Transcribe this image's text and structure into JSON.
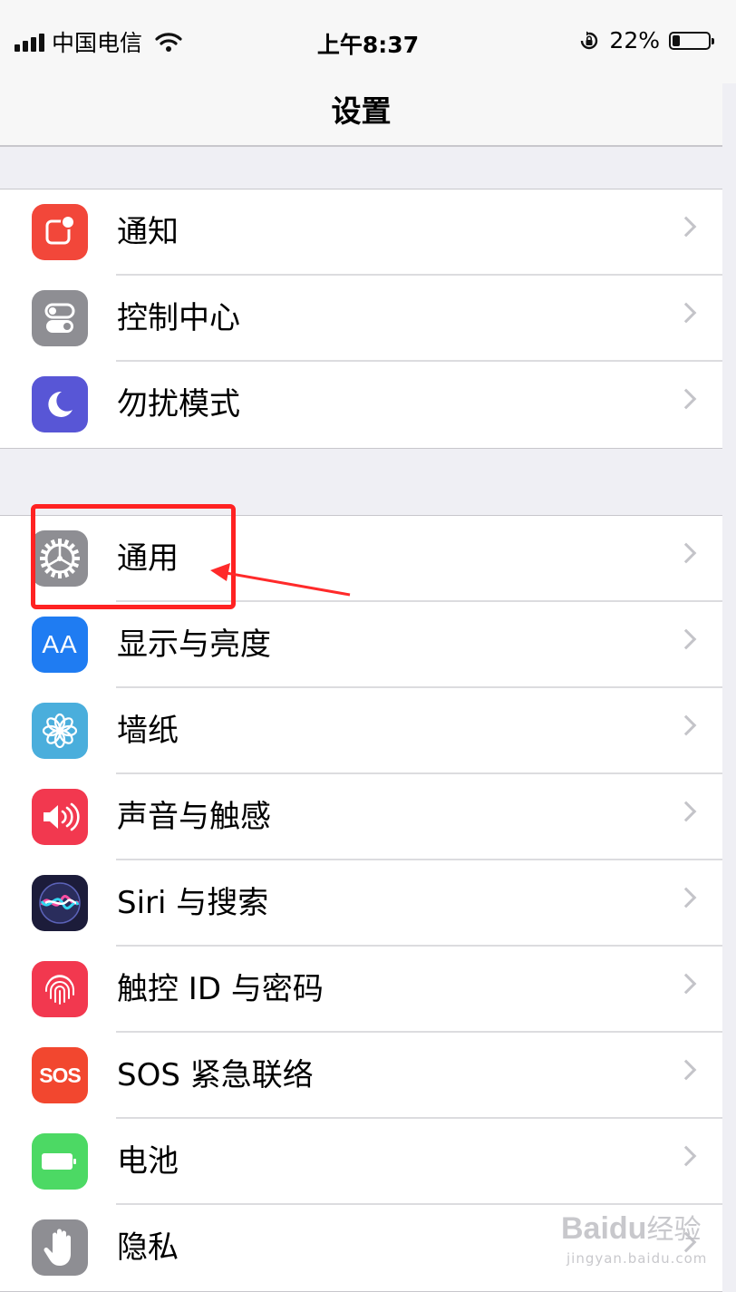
{
  "status_bar": {
    "carrier": "中国电信",
    "time": "上午8:37",
    "battery_percent": "22%",
    "battery_level": 0.22
  },
  "nav": {
    "title": "设置"
  },
  "groups": [
    {
      "items": [
        {
          "label": "通知",
          "icon": "notifications-icon",
          "color": "#f2473a"
        },
        {
          "label": "控制中心",
          "icon": "control-center-icon",
          "color": "#8e8e93"
        },
        {
          "label": "勿扰模式",
          "icon": "moon-icon",
          "color": "#5856d6"
        }
      ]
    },
    {
      "items": [
        {
          "label": "通用",
          "icon": "gear-icon",
          "color": "#8e8e93"
        },
        {
          "label": "显示与亮度",
          "icon": "display-brightness-icon",
          "color": "#1f7cf2",
          "glyph": "AA"
        },
        {
          "label": "墙纸",
          "icon": "wallpaper-flower-icon",
          "color": "#4aaedc"
        },
        {
          "label": "声音与触感",
          "icon": "speaker-icon",
          "color": "#f2384f"
        },
        {
          "label": "Siri 与搜索",
          "icon": "siri-icon",
          "color": "#1c1c3a"
        },
        {
          "label": "触控 ID 与密码",
          "icon": "fingerprint-icon",
          "color": "#f2384f"
        },
        {
          "label": "SOS 紧急联络",
          "icon": "sos-icon",
          "color": "#f2472f",
          "glyph": "SOS"
        },
        {
          "label": "电池",
          "icon": "battery-icon",
          "color": "#4cd964"
        },
        {
          "label": "隐私",
          "icon": "hand-icon",
          "color": "#8e8e93"
        }
      ]
    }
  ],
  "annotation": {
    "color": "#ff2a2a"
  },
  "watermark": {
    "logo": "Baidu",
    "text": "经验",
    "url": "jingyan.baidu.com"
  }
}
